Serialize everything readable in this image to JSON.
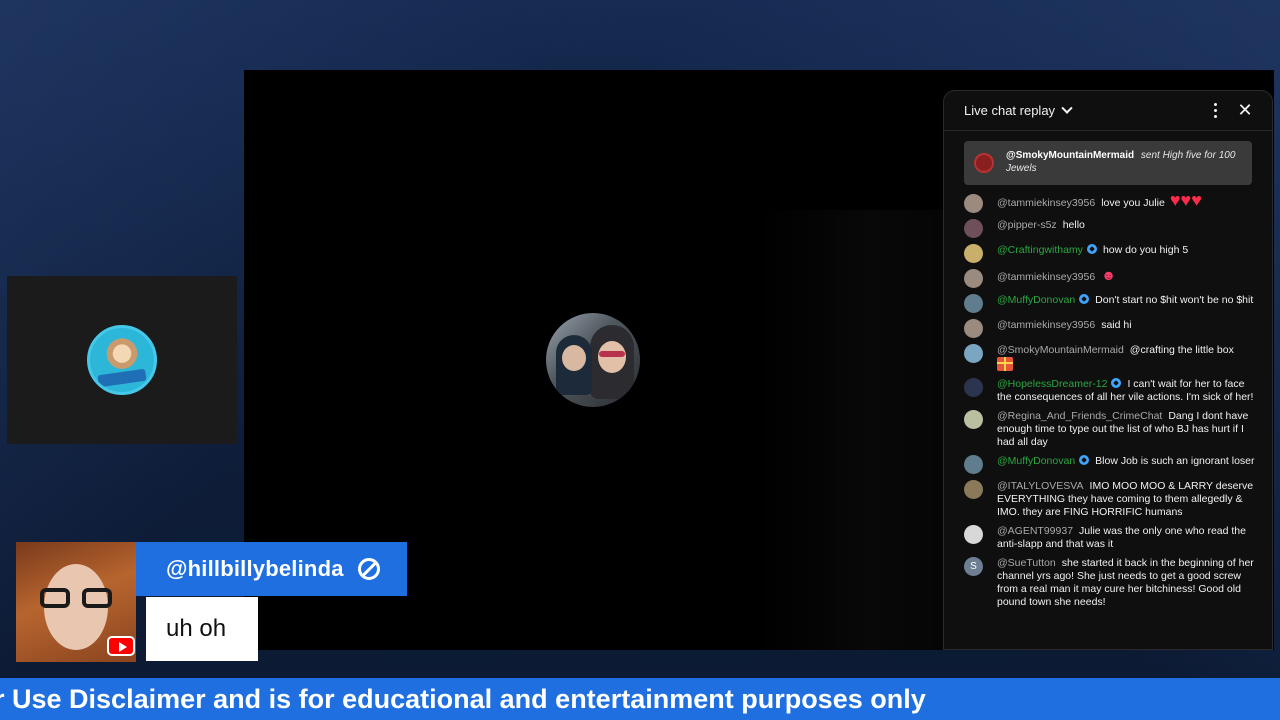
{
  "chat": {
    "title": "Live chat replay",
    "paid_message": {
      "user": "@SmokyMountainMermaid",
      "text": "sent High five for 100 Jewels"
    },
    "messages": [
      {
        "user": "@tammiekinsey3956",
        "text": "love you Julie",
        "member": false,
        "avatar_color": "#9b8a7e",
        "extra": "hearts"
      },
      {
        "user": "@pipper-s5z",
        "text": "hello",
        "member": false,
        "avatar_color": "#6e4f5a",
        "extra": ""
      },
      {
        "user": "@Craftingwithamy",
        "text": "how do you high 5",
        "member": true,
        "avatar_color": "#c9b06a",
        "extra": ""
      },
      {
        "user": "@tammiekinsey3956",
        "text": "",
        "member": false,
        "avatar_color": "#9b8a7e",
        "extra": "emoji"
      },
      {
        "user": "@MuffyDonovan",
        "text": "Don't start no $hit won't be no $hit",
        "member": true,
        "avatar_color": "#5f7d8c",
        "extra": ""
      },
      {
        "user": "@tammiekinsey3956",
        "text": "said hi",
        "member": false,
        "avatar_color": "#9b8a7e",
        "extra": ""
      },
      {
        "user": "@SmokyMountainMermaid",
        "text": "@crafting the little box",
        "member": false,
        "avatar_color": "#7aa6c2",
        "extra": "gift"
      },
      {
        "user": "@HopelessDreamer-12",
        "text": "I can't wait for her to face the consequences of all her vile actions. I'm sick of her!",
        "member": true,
        "avatar_color": "#2b3550",
        "extra": ""
      },
      {
        "user": "@Regina_And_Friends_CrimeChat",
        "text": "Dang I dont have enough time to type out the list of who BJ has hurt if I had all day",
        "member": false,
        "avatar_color": "#b9c0a0",
        "extra": ""
      },
      {
        "user": "@MuffyDonovan",
        "text": "Blow Job is such an ignorant loser",
        "member": true,
        "avatar_color": "#5f7d8c",
        "extra": ""
      },
      {
        "user": "@ITALYLOVESVA",
        "text": "IMO MOO MOO & LARRY deserve EVERYTHING they have coming to them allegedly & IMO. they are FING HORRIFIC humans",
        "member": false,
        "avatar_color": "#8a7a5a",
        "extra": ""
      },
      {
        "user": "@AGENT99937",
        "text": "Julie was the only one who read the anti-slapp and that was it",
        "member": false,
        "avatar_color": "#d8d8d8",
        "extra": ""
      },
      {
        "user": "@SueTutton",
        "text": "she started it back in the beginning of her channel yrs ago! She just needs to get a good screw from a real man it may cure her bitchiness! Good old pound town she needs!",
        "member": false,
        "avatar_color": "#6e7f94",
        "avatar_letter": "S",
        "extra": ""
      }
    ]
  },
  "lower_third": {
    "handle": "@hillbillybelinda",
    "message": "uh oh"
  },
  "ticker": {
    "text": "r Use Disclaimer and is for educational and entertainment purposes only"
  },
  "colors": {
    "accent_blue": "#1f6fe0",
    "member_green": "#2ba640",
    "badge_blue": "#3ea6ff",
    "stage": "#000000",
    "chat_bg": "#0f0f0f"
  },
  "icons": {
    "chat_menu": "more-vertical-icon",
    "chat_close": "close-icon",
    "chat_title_chevron": "chevron-down-icon",
    "handle_badge": "ban-icon",
    "platform": "youtube-icon"
  }
}
